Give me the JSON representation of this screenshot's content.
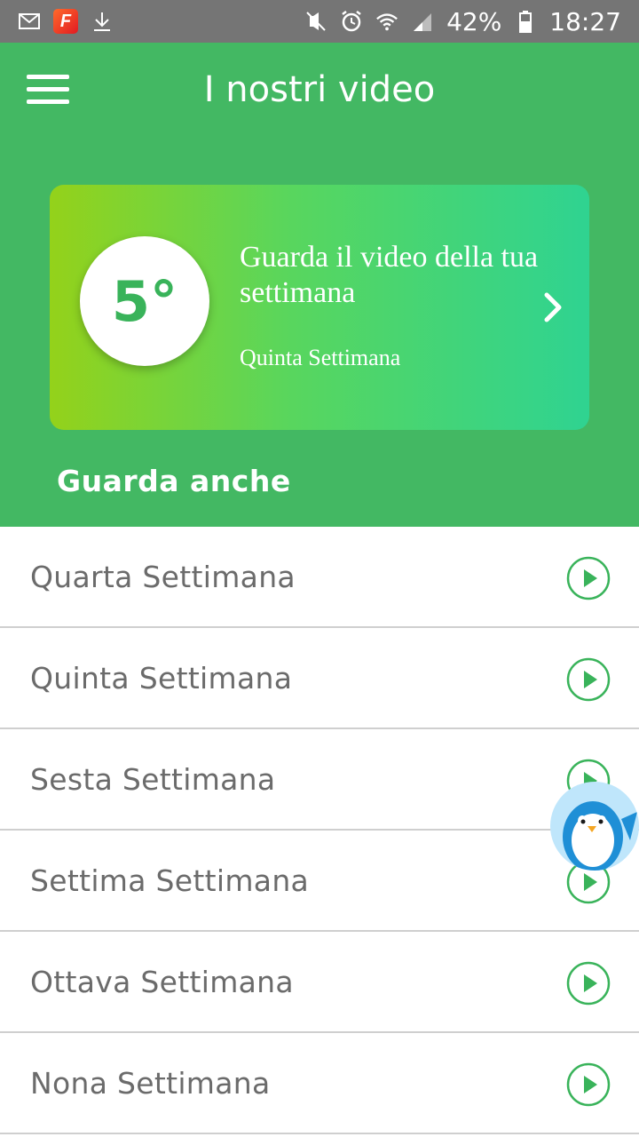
{
  "status_bar": {
    "battery": "42%",
    "time": "18:27",
    "icons": [
      "gmail-icon",
      "flipboard-icon",
      "download-icon",
      "mute-icon",
      "alarm-icon",
      "wifi-icon",
      "signal-icon",
      "battery-icon"
    ],
    "flipboard_letter": "F"
  },
  "header": {
    "title": "I nostri video"
  },
  "current_week": {
    "number": "5°",
    "title": "Guarda il video della tua settimana",
    "subtitle": "Quinta Settimana"
  },
  "section": {
    "title": "Guarda anche"
  },
  "list": {
    "items": [
      {
        "label": "Quarta Settimana"
      },
      {
        "label": "Quinta Settimana"
      },
      {
        "label": "Sesta Settimana"
      },
      {
        "label": "Settima Settimana"
      },
      {
        "label": "Ottava Settimana"
      },
      {
        "label": "Nona Settimana"
      }
    ]
  },
  "colors": {
    "header_green": "#43b863",
    "accent_green": "#39b35a",
    "status_bar": "#757575",
    "list_text": "#6b6b6b"
  }
}
